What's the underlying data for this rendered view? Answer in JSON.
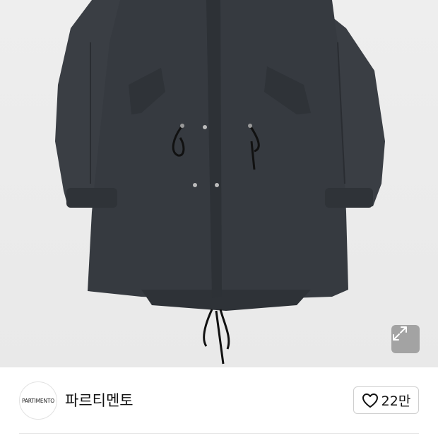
{
  "product_image": {
    "alt": "",
    "expand_icon": "expand-arrows-icon"
  },
  "brand": {
    "logo_text": "PARTIMENTO",
    "name": "파르티멘토"
  },
  "like": {
    "icon": "heart-outline-icon",
    "count": "22만"
  },
  "colors": {
    "coat": "#3a3e44",
    "background": "#ededed"
  }
}
